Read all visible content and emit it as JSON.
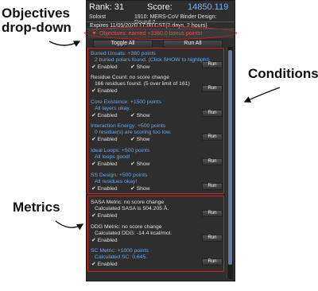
{
  "annotations": {
    "objectives_line1": "Objectives",
    "objectives_line2": "drop-down",
    "conditions": "Conditions",
    "metrics": "Metrics"
  },
  "header": {
    "rank_text": "Rank: 31",
    "score_label": "Score:",
    "score_value": "14850.119",
    "mode": "Soloist",
    "puzzle": "1910: MERS-CoV Binder Design: Round 2",
    "expires": "Expires 11/05/2020 17:00 CST(2 days, 2 hours)"
  },
  "objectives_bar": {
    "arrow": "▼",
    "text": "Objectives: earned +3380.0 bonus points!"
  },
  "buttons": {
    "toggle_all": "Toggle All",
    "run_all": "Run All"
  },
  "objectives": [
    {
      "title": "Buried Unsats: +380 points",
      "desc": "2 buried polars found. (Click SHOW to highlight)",
      "desc2": "",
      "enabled": "Enabled",
      "show": "Show",
      "run": "Run",
      "has_show": true,
      "white": false
    },
    {
      "title": "Residue Count: no score change",
      "desc": "166 residues found. (5 over limit of 161)",
      "desc2": "",
      "enabled": "Enabled",
      "show": "",
      "run": "Run",
      "has_show": false,
      "white": true
    },
    {
      "title": "Core Existence: +1500 points",
      "desc": "All layers okay.",
      "desc2": "",
      "enabled": "Enabled",
      "show": "Show",
      "run": "Run",
      "has_show": true,
      "white": false
    },
    {
      "title": "Interaction Energy: +500 points",
      "desc": "0 residue(s) are scoring too low.",
      "desc2": "",
      "enabled": "Enabled",
      "show": "Show",
      "run": "Run",
      "has_show": true,
      "white": false
    },
    {
      "title": "Ideal Loops: +500 points",
      "desc": "All loops good!",
      "desc2": "",
      "enabled": "Enabled",
      "show": "Show",
      "run": "Run",
      "has_show": true,
      "white": false
    },
    {
      "title": "SS Design: +500 points",
      "desc": "All residues okay!",
      "desc2": "",
      "enabled": "Enabled",
      "show": "Show",
      "run": "Run",
      "has_show": true,
      "white": false
    }
  ],
  "metrics": [
    {
      "title": "SASA Metric: no score change",
      "desc": "Calculated SASA is 504.205 Å.",
      "enabled": "Enabled",
      "run": "Run",
      "white": true
    },
    {
      "title": "DDG Metric: no score change",
      "desc": "Calculated DDG: -14.4 kcal/mol.",
      "enabled": "Enabled",
      "run": "Run",
      "white": true
    },
    {
      "title": "SC Metric: +1000 points",
      "desc": "Calculated SC: 0.645.",
      "enabled": "Enabled",
      "run": "Run",
      "white": false
    }
  ],
  "colors": {
    "panel_bg": "#2e2e2e",
    "blue_text": "#6fa8e8",
    "score_blue": "#6fb2ff",
    "red_accent": "#d42020"
  }
}
